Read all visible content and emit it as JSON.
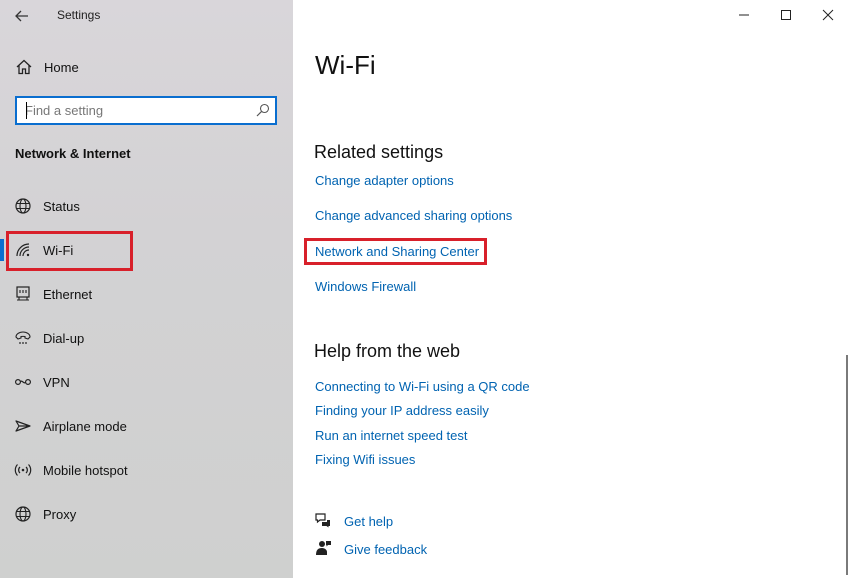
{
  "app": {
    "title": "Settings"
  },
  "sidebar": {
    "home_label": "Home",
    "search": {
      "placeholder": "Find a setting",
      "value": ""
    },
    "section_title": "Network & Internet",
    "items": [
      {
        "label": "Status",
        "icon": "globe-icon"
      },
      {
        "label": "Wi-Fi",
        "icon": "wifi-icon",
        "active": true
      },
      {
        "label": "Ethernet",
        "icon": "ethernet-icon"
      },
      {
        "label": "Dial-up",
        "icon": "dialup-icon"
      },
      {
        "label": "VPN",
        "icon": "vpn-icon"
      },
      {
        "label": "Airplane mode",
        "icon": "airplane-icon"
      },
      {
        "label": "Mobile hotspot",
        "icon": "hotspot-icon"
      },
      {
        "label": "Proxy",
        "icon": "globe-icon"
      }
    ]
  },
  "main": {
    "title": "Wi-Fi",
    "related": {
      "heading": "Related settings",
      "links": [
        "Change adapter options",
        "Change advanced sharing options",
        "Network and Sharing Center",
        "Windows Firewall"
      ]
    },
    "help": {
      "heading": "Help from the web",
      "links": [
        "Connecting to Wi-Fi using a QR code",
        "Finding your IP address easily",
        "Run an internet speed test",
        "Fixing Wifi issues"
      ]
    },
    "footer": {
      "get_help": "Get help",
      "give_feedback": "Give feedback"
    }
  },
  "colors": {
    "accent": "#0a6ecf",
    "link": "#0063b1",
    "highlight": "#d8202a"
  }
}
